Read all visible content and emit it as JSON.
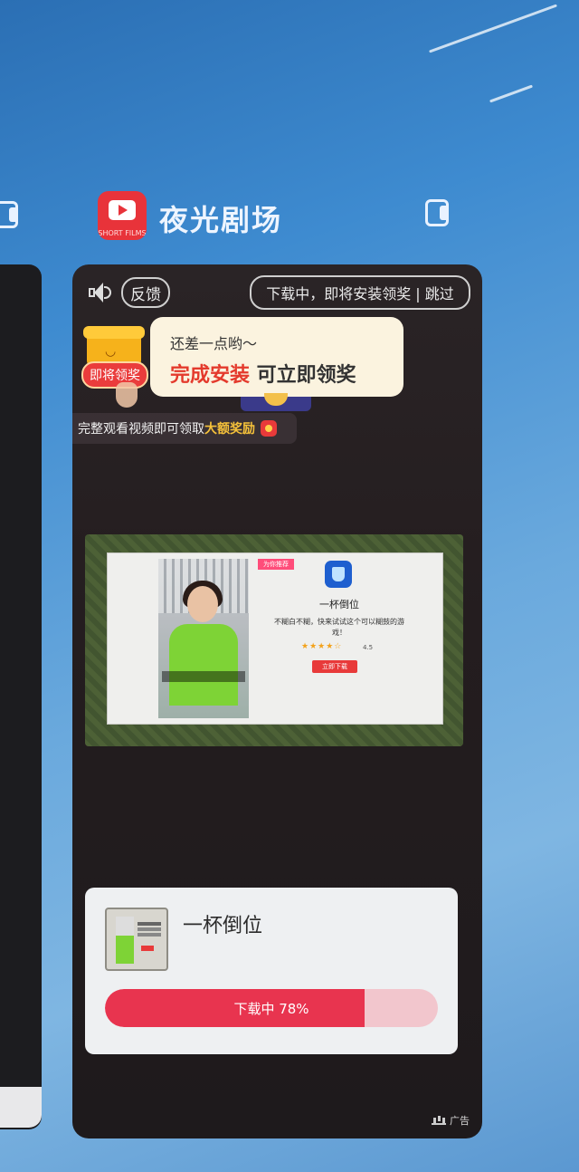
{
  "app": {
    "name": "夜光剧场",
    "icon_subtext": "SHORT FILMS"
  },
  "ad_card": {
    "feedback_label": "反馈",
    "skip_label": "下载中，即将安装领奖 | 跳过",
    "reward_badge": "即将领奖",
    "bubble": {
      "line1": "还差一点哟～",
      "highlight": "完成安装",
      "rest": " 可立即领奖"
    },
    "watch_prefix": "完整观看视频即可领取",
    "watch_bonus": "大额奖励",
    "video": {
      "tag": "为你推荐",
      "app_name": "一杯倒位",
      "description": "不糊白不糊，快来试试这个可以糊鼓的游戏！",
      "stars": "★★★★☆",
      "rating": "4.5",
      "download_label": "立即下载"
    },
    "download": {
      "app_name": "一杯倒位",
      "progress_label": "下载中 78%",
      "progress": 0.78
    },
    "ad_label": "广告"
  },
  "colors": {
    "accent_red": "#e8344f",
    "gold": "#f6c23a"
  },
  "icons": [
    "speaker-icon",
    "lock-icon",
    "gift-icon",
    "red-packet-icon"
  ]
}
